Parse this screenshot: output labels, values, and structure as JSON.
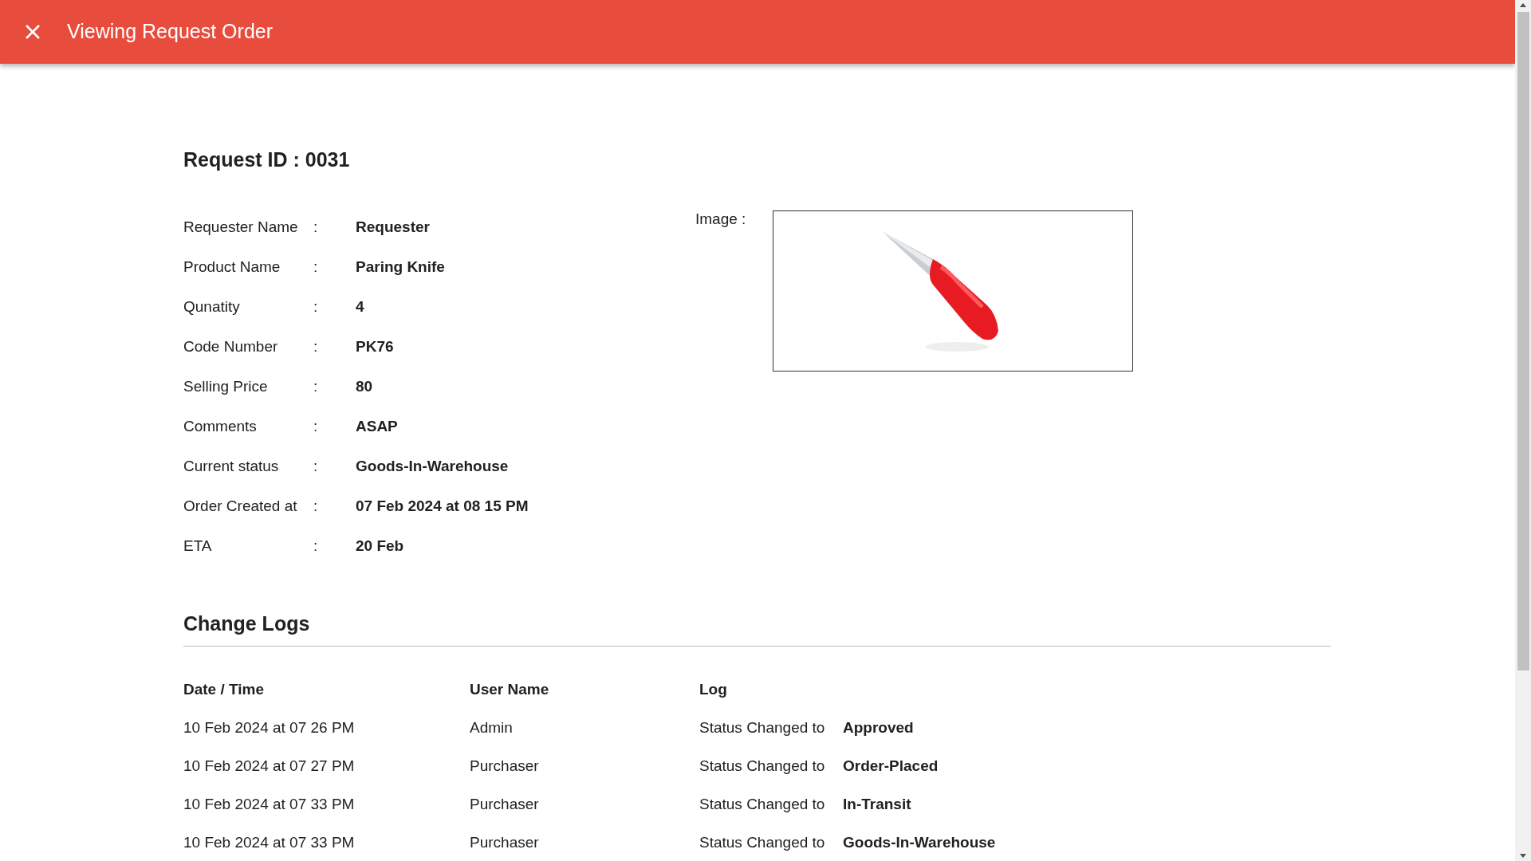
{
  "header": {
    "title": "Viewing Request Order"
  },
  "request_id": "Request ID : 0031",
  "details": [
    {
      "label": "Requester Name",
      "separator": ":",
      "value": "Requester"
    },
    {
      "label": "Product Name",
      "separator": ":",
      "value": "Paring Knife"
    },
    {
      "label": "Qunatity",
      "separator": ":",
      "value": "4"
    },
    {
      "label": "Code Number",
      "separator": ":",
      "value": "PK76"
    },
    {
      "label": "Selling Price",
      "separator": ":",
      "value": "80"
    },
    {
      "label": "Comments",
      "separator": ":",
      "value": "ASAP"
    },
    {
      "label": "Current status",
      "separator": ":",
      "value": "Goods-In-Warehouse"
    },
    {
      "label": "Order Created at",
      "separator": ":",
      "value": "07 Feb 2024 at 08 15 PM"
    },
    {
      "label": "ETA",
      "separator": ":",
      "value": "20 Feb"
    }
  ],
  "image": {
    "label": "Image :"
  },
  "change_logs": {
    "title": "Change Logs",
    "columns": [
      "Date / Time",
      "User Name",
      "Log"
    ],
    "rows": [
      {
        "date_time": "10 Feb 2024 at 07 26 PM",
        "user_name": "Admin",
        "log_prefix": "Status Changed to",
        "log_status": "Approved"
      },
      {
        "date_time": "10 Feb 2024 at 07 27 PM",
        "user_name": "Purchaser",
        "log_prefix": "Status Changed to",
        "log_status": "Order-Placed"
      },
      {
        "date_time": "10 Feb 2024 at 07 33 PM",
        "user_name": "Purchaser",
        "log_prefix": "Status Changed to",
        "log_status": "In-Transit"
      },
      {
        "date_time": "10 Feb 2024 at 07 33 PM",
        "user_name": "Purchaser",
        "log_prefix": "Status Changed to",
        "log_status": "Goods-In-Warehouse"
      }
    ]
  }
}
